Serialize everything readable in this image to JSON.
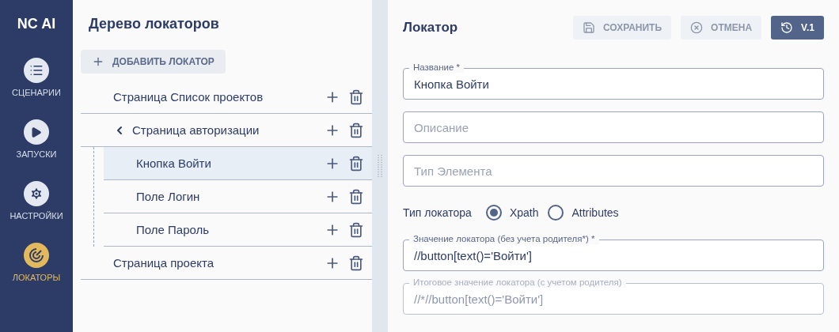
{
  "sidebar": {
    "logo": "NC AI",
    "items": [
      {
        "kind": "list",
        "label": "СЦЕНАРИИ",
        "selected": false
      },
      {
        "kind": "play",
        "label": "ЗАПУСКИ",
        "selected": false
      },
      {
        "kind": "gear",
        "label": "НАСТРОЙКИ",
        "selected": false
      },
      {
        "kind": "locator",
        "label": "ЛОКАТОРЫ",
        "selected": true
      }
    ]
  },
  "tree": {
    "title": "Дерево локаторов",
    "add_button": "ДОБАВИТЬ ЛОКАТОР",
    "items": [
      {
        "label": "Страница Список проектов",
        "selected": false
      },
      {
        "label": "Страница авторизации",
        "selected": false,
        "expanded": true,
        "children": [
          {
            "label": "Кнопка Войти",
            "selected": true
          },
          {
            "label": "Поле Логин",
            "selected": false
          },
          {
            "label": "Поле Пароль",
            "selected": false
          }
        ]
      },
      {
        "label": "Страница проекта",
        "selected": false
      }
    ]
  },
  "form": {
    "title": "Локатор",
    "buttons": [
      {
        "kind": "save",
        "label": "СОХРАНИТЬ"
      },
      {
        "kind": "cancel",
        "label": "ОТМЕНА"
      },
      {
        "kind": "version",
        "label": "V.1"
      }
    ],
    "fields": [
      {
        "label": "Название *",
        "value": "Кнопка Войти",
        "disabled": false
      },
      {
        "placeholder": "Описание",
        "disabled": false
      },
      {
        "placeholder": "Тип Элемента",
        "disabled": false
      }
    ],
    "locator_type": {
      "label": "Тип локатора",
      "options": [
        {
          "label": "Xpath",
          "selected": true
        },
        {
          "label": "Attributes",
          "selected": false
        }
      ]
    },
    "value_fields": [
      {
        "label": "Значение локатора (без учета родителя*) *",
        "value": "//button[text()='Войти']",
        "disabled": false
      },
      {
        "label": "Итоговое значение локатора (с учетом родителя)",
        "value": "//*//button[text()='Войти']",
        "disabled": true
      }
    ]
  }
}
